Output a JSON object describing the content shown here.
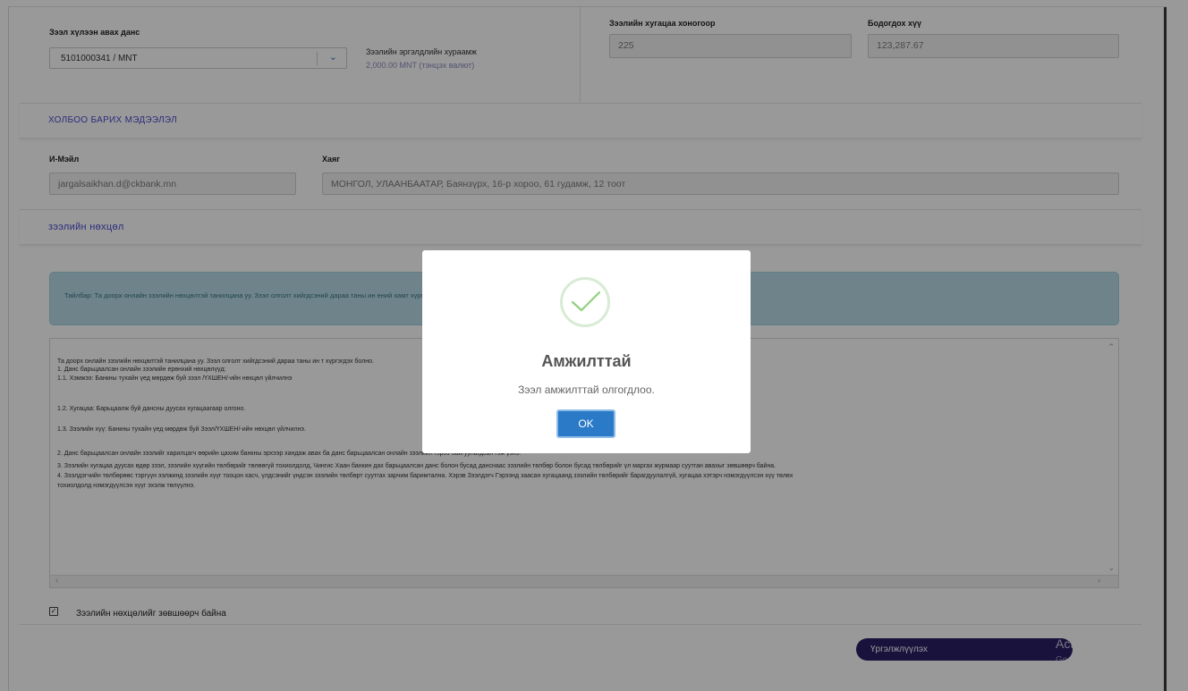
{
  "account": {
    "label": "Зээл хүлээн авах данс",
    "value": "5101000341 / MNT"
  },
  "turnover": {
    "label": "Зээлийн эргэлдлийн хураамж",
    "value": "2,000.00 MNT (тэнцэх валют)"
  },
  "loan_days": {
    "label": "Зээлийн хугацаа хоногоор",
    "value": "225"
  },
  "interest": {
    "label": "Бодогдох хүү",
    "value": "123,287.67"
  },
  "contact": {
    "heading": "ХОЛБОО БАРИХ МЭДЭЭЛЭЛ",
    "email_label": "И-Мэйл",
    "email_value": "jargalsaikhan.d@ckbank.mn",
    "address_label": "Хаяг",
    "address_value": "МОНГОЛ, УЛААНБААТАР, Баянзүрх, 16-р хороо, 61 гудамж, 12 тоот"
  },
  "terms_section": {
    "heading": "зээлийн нөхцөл",
    "note": "Тайлбар: Та доорх онлайн зээлийн нөхцөлтэй танилцана уу. Зээл олголт хийгдсэний дараа таны ин                                                                                                                                        ений хамт хүргэгдэх болно.",
    "lines": [
      "Та доорх онлайн зээлийн нөхцөлтэй танилцана уу. Зээл олголт хийгдсэний дараа таны ин                                                                                                                               ᴛ хүргэгдэх болно.",
      "1. Данс барьцаалсан онлайн зээлийн ерөнхий нөхцөлүүд:",
      "1.1. Хэмжээ: Банкны тухайн үед мөрдөж буй зээл /ҮХШЕН/-ийн нөхцөл үйлчилнэ",
      "",
      "1.2. Хугацаа: Барьцаалж буй дансны дуусах хугацаагаар олгоно.",
      "",
      "1.3. Зээлийн хүү: Банкны тухайн үед мөрдөж буй Зээл/ҮХШЕН/-ийн нөхцөл үйлчилнэ.",
      "",
      "2. Данс барьцаалсан онлайн зээлийг харилцагч өөрийн цахим банкны эрхээр хандаж авах ба данс барьцаалсан онлайн зээлийн гэрээ байгуулагдсан гэж үзнэ.",
      "3. Зээлийн хугацаа дуусах өдөр зээл, зээлийн хүүгийн төлбөрийг төлөөгүй тохиолдолд, Чингис Хаан банкин дах барьцаалсан данс болон бусад данснаас зээлийн төлбөр болон бусад төлбөрийг үл маргах журмаар суутган авахыг зөвшөөрч байна.",
      "4. Зээлдэгчийн төлбөрөөс тэргүүн ээлжинд зээлийн хүүг тооцон хасч, үлдсэнийг үндсэн зээлийн төлбөрт суутгах зарчим баримтална. Хэрэв Зээлдэгч Гэрээнд заасан хугацаанд зээлийн төлбөрийг барагдуулалгүй, хугацаа хэтэрч нэмэгдүүлсэн хүү төлөх",
      "тохиолдолд нэмэгдүүлсэн хүүг эхэлж төлүүлнэ."
    ]
  },
  "agree": {
    "label": "Зээлийн нөхцөлийг зөвшөөрч байна",
    "checked": true
  },
  "continue_label": "Үргэлжлүүлэх",
  "watermark": {
    "line1": "Activate Windows",
    "line2": "Go to Settings to activate Windows."
  },
  "modal": {
    "title": "Амжилттай",
    "message": "Зээл амжилттай олгогдлоо.",
    "ok_label": "OK"
  },
  "colors": {
    "accent": "#4a4ad0",
    "primary_button": "#2a7ac7",
    "continue_button": "#2b1f66",
    "success": "#8fd17f",
    "note_bg": "#b7dde7"
  }
}
